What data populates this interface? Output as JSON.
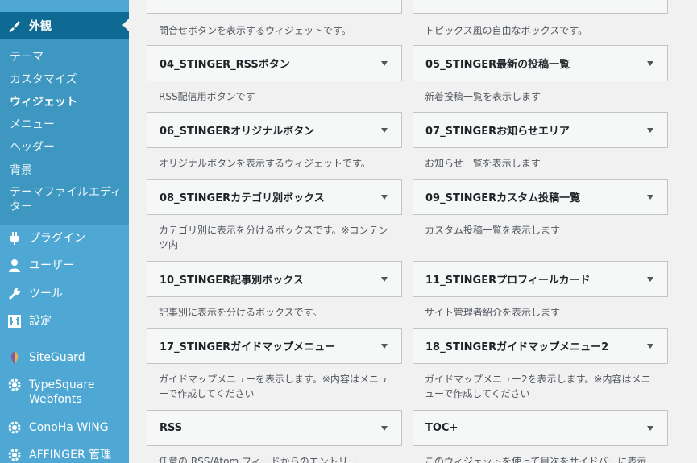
{
  "sidebar": {
    "active": {
      "label": "外観"
    },
    "submenu": [
      "テーマ",
      "カスタマイズ",
      "ウィジェット",
      "メニュー",
      "ヘッダー",
      "背景",
      "テーマファイルエディター"
    ],
    "items": [
      {
        "label": "プラグイン",
        "icon": "plugin-icon"
      },
      {
        "label": "ユーザー",
        "icon": "user-icon"
      },
      {
        "label": "ツール",
        "icon": "wrench-icon"
      },
      {
        "label": "設定",
        "icon": "settings-icon"
      },
      {
        "label": "SiteGuard",
        "icon": "siteguard-icon"
      },
      {
        "label": "TypeSquare Webfonts",
        "icon": "gear-icon"
      },
      {
        "label": "ConoHa WING",
        "icon": "gear-icon"
      },
      {
        "label": "AFFINGER 管理",
        "icon": "gear-icon"
      }
    ]
  },
  "widgets": {
    "left": [
      {
        "title": "",
        "desc": "問合せボタンを表示するウィジェットです。"
      },
      {
        "title": "04_STINGER_RSSボタン",
        "desc": "RSS配信用ボタンです"
      },
      {
        "title": "06_STINGERオリジナルボタン",
        "desc": "オリジナルボタンを表示するウィジェットです。"
      },
      {
        "title": "08_STINGERカテゴリ別ボックス",
        "desc": "カテゴリ別に表示を分けるボックスです。※コンテンツ内"
      },
      {
        "title": "10_STINGER記事別ボックス",
        "desc": "記事別に表示を分けるボックスです。"
      },
      {
        "title": "17_STINGERガイドマップメニュー",
        "desc": "ガイドマップメニューを表示します。※内容はメニューで作成してください"
      },
      {
        "title": "RSS",
        "desc": "任意の RSS/Atom フィードからのエントリー"
      }
    ],
    "right": [
      {
        "title": "",
        "desc": "トピックス風の自由なボックスです。"
      },
      {
        "title": "05_STINGER最新の投稿一覧",
        "desc": "新着投稿一覧を表示します"
      },
      {
        "title": "07_STINGERお知らせエリア",
        "desc": "お知らせ一覧を表示します"
      },
      {
        "title": "09_STINGERカスタム投稿一覧",
        "desc": "カスタム投稿一覧を表示します"
      },
      {
        "title": "11_STINGERプロフィールカード",
        "desc": "サイト管理者紹介を表示します"
      },
      {
        "title": "18_STINGERガイドマップメニュー2",
        "desc": "ガイドマップメニュー2を表示します。※内容はメニューで作成してください"
      },
      {
        "title": "TOC+",
        "desc": "このウィジェットを使って目次をサイドバーに表示"
      }
    ]
  }
}
